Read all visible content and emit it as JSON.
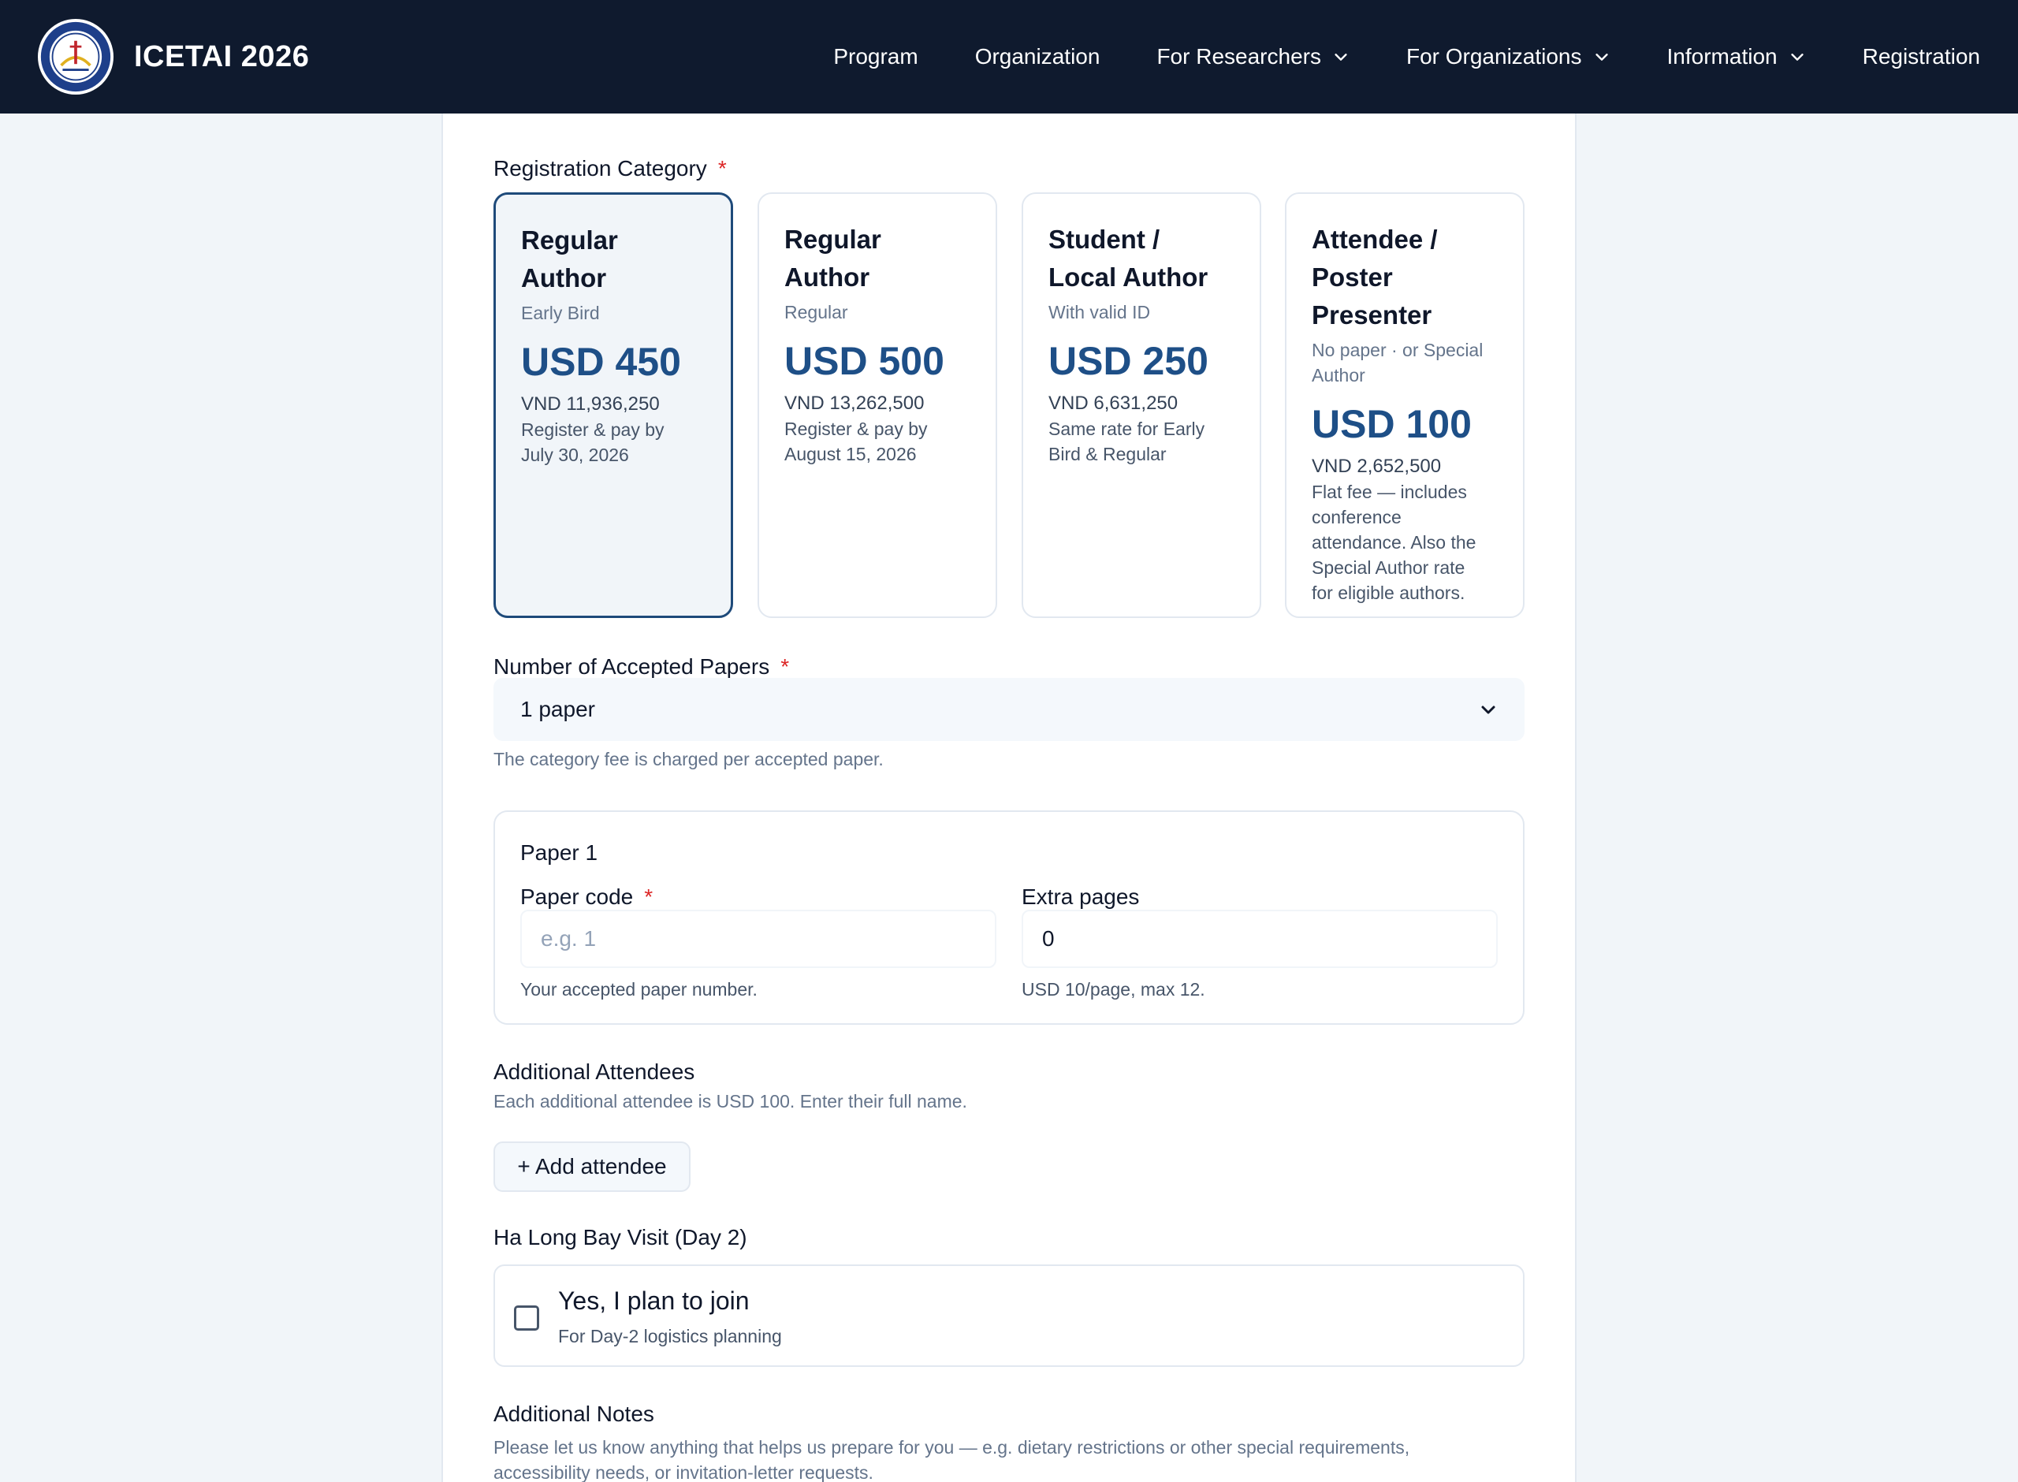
{
  "brand": {
    "name": "ICETAI 2026"
  },
  "nav": {
    "program": "Program",
    "organization": "Organization",
    "for_researchers": "For Researchers",
    "for_organizations": "For Organizations",
    "information": "Information",
    "registration": "Registration"
  },
  "form": {
    "category_label": "Registration Category",
    "required_mark": "*",
    "categories": [
      {
        "title_line1": "Regular Author",
        "title_line2": "",
        "title_line3": "",
        "subtitle_line1": "Early Bird",
        "subtitle_line2": "",
        "price": "USD 450",
        "vnd": "VND 11,936,250",
        "note_line1": "Register & pay by",
        "note_line2": "July 30, 2026",
        "note_line3": "",
        "note_line4": "",
        "note_line5": "",
        "selected": true
      },
      {
        "title_line1": "Regular Author",
        "title_line2": "",
        "title_line3": "",
        "subtitle_line1": "Regular",
        "subtitle_line2": "",
        "price": "USD 500",
        "vnd": "VND 13,262,500",
        "note_line1": "Register & pay by",
        "note_line2": "August 15, 2026",
        "note_line3": "",
        "note_line4": "",
        "note_line5": "",
        "selected": false
      },
      {
        "title_line1": "Student /",
        "title_line2": "Local Author",
        "title_line3": "",
        "subtitle_line1": "With valid ID",
        "subtitle_line2": "",
        "price": "USD 250",
        "vnd": "VND 6,631,250",
        "note_line1": "Same rate for Early",
        "note_line2": "Bird & Regular",
        "note_line3": "",
        "note_line4": "",
        "note_line5": "",
        "selected": false
      },
      {
        "title_line1": "Attendee /",
        "title_line2": "Poster",
        "title_line3": "Presenter",
        "subtitle_line1": "No paper · or Special",
        "subtitle_line2": "Author",
        "price": "USD 100",
        "vnd": "VND 2,652,500",
        "note_line1": "Flat fee — includes",
        "note_line2": "conference",
        "note_line3": "attendance. Also the",
        "note_line4": "Special Author rate",
        "note_line5": "for eligible authors.",
        "selected": false
      }
    ],
    "papers_label": "Number of Accepted Papers",
    "papers_value": "1 paper",
    "papers_hint": "The category fee is charged per accepted paper.",
    "paper": {
      "title": "Paper 1",
      "code_label": "Paper code",
      "code_placeholder": "e.g. 1",
      "code_hint": "Your accepted paper number.",
      "extra_label": "Extra pages",
      "extra_value": "0",
      "extra_hint": "USD 10/page, max 12."
    },
    "attendees_label": "Additional Attendees",
    "attendees_hint": "Each additional attendee is USD 100. Enter their full name.",
    "add_attendee": "+ Add attendee",
    "halong_label": "Ha Long Bay Visit (Day 2)",
    "halong_option": "Yes, I plan to join",
    "halong_sub": "For Day-2 logistics planning",
    "notes_label": "Additional Notes",
    "notes_hint_line1": "Please let us know anything that helps us prepare for you — e.g. dietary restrictions or other special requirements,",
    "notes_hint_line2": "accessibility needs, or invitation-letter requests."
  },
  "colors": {
    "navbar": "#0f1a2e",
    "accent_price": "#1e4f87",
    "required": "#dc2626",
    "selected_border": "#1e4a7a"
  }
}
